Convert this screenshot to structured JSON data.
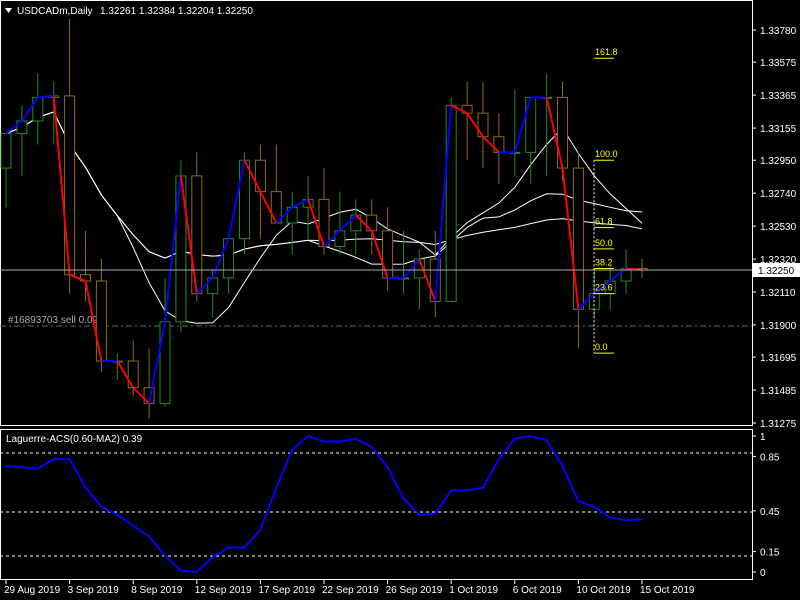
{
  "header": {
    "symbol_label": "USDCADm,Daily",
    "ohlc": "1.32261 1.32384 1.32204 1.32250",
    "menu_icon": "triangle-down-icon"
  },
  "order_label": "#16893703 sell 0.02",
  "indicator_label": "Laguerre-ACS(0.60-MA2) 0.39",
  "price_axis": {
    "ticks": [
      "1.33780",
      "1.33575",
      "1.33365",
      "1.33155",
      "1.32950",
      "1.32740",
      "1.32530",
      "1.32320",
      "1.32110",
      "1.31900",
      "1.31695",
      "1.31485",
      "1.31275"
    ],
    "current_price": "1.32250"
  },
  "indicator_axis": {
    "ticks": [
      "1",
      "0.85",
      "0.45",
      "0.15",
      "0"
    ]
  },
  "time_axis": {
    "labels": [
      "29 Aug 2019",
      "3 Sep 2019",
      "8 Sep 2019",
      "12 Sep 2019",
      "17 Sep 2019",
      "22 Sep 2019",
      "26 Sep 2019",
      "1 Oct 2019",
      "6 Oct 2019",
      "10 Oct 2019",
      "15 Oct 2019"
    ]
  },
  "fibonacci": {
    "levels": [
      "161.8",
      "100.0",
      "61.8",
      "50.0",
      "38.2",
      "23.6",
      "0.0"
    ]
  },
  "colors": {
    "background": "#000000",
    "axis": "#ffffff",
    "bull_candle": "#228b22",
    "bear_candle": "#8b6b1e",
    "zigzag_up": "#0000ff",
    "zigzag_down": "#ff0000",
    "moving_average": "#ffffff",
    "fib": "#ffff00",
    "order_line": "#2e8b2e",
    "indicator": "#0000ff"
  },
  "chart_data": [
    {
      "type": "candlestick",
      "title": "USDCADm,Daily",
      "ylim": [
        1.3125,
        1.339
      ],
      "x": [
        "29 Aug 2019",
        "30 Aug 2019",
        "1 Sep 2019",
        "2 Sep 2019",
        "3 Sep 2019",
        "4 Sep 2019",
        "5 Sep 2019",
        "6 Sep 2019",
        "8 Sep 2019",
        "9 Sep 2019",
        "10 Sep 2019",
        "11 Sep 2019",
        "12 Sep 2019",
        "13 Sep 2019",
        "15 Sep 2019",
        "16 Sep 2019",
        "17 Sep 2019",
        "18 Sep 2019",
        "19 Sep 2019",
        "20 Sep 2019",
        "22 Sep 2019",
        "23 Sep 2019",
        "24 Sep 2019",
        "25 Sep 2019",
        "26 Sep 2019",
        "27 Sep 2019",
        "29 Sep 2019",
        "30 Sep 2019",
        "1 Oct 2019",
        "2 Oct 2019",
        "3 Oct 2019",
        "4 Oct 2019",
        "6 Oct 2019",
        "7 Oct 2019",
        "8 Oct 2019",
        "9 Oct 2019",
        "10 Oct 2019",
        "11 Oct 2019",
        "13 Oct 2019",
        "14 Oct 2019",
        "15 Oct 2019"
      ],
      "series": [
        {
          "name": "open",
          "values": [
            1.329,
            1.3312,
            1.332,
            1.3335,
            1.3336,
            1.3222,
            1.3218,
            1.3167,
            1.3167,
            1.315,
            1.314,
            1.3192,
            1.3285,
            1.321,
            1.322,
            1.3245,
            1.3295,
            1.3275,
            1.3255,
            1.3265,
            1.327,
            1.324,
            1.325,
            1.326,
            1.325,
            1.322,
            1.322,
            1.3232,
            1.3205,
            1.333,
            1.3325,
            1.331,
            1.33,
            1.33,
            1.3335,
            1.3335,
            1.329,
            1.32,
            1.321,
            1.3218,
            1.3226
          ]
        },
        {
          "name": "high",
          "values": [
            1.3305,
            1.333,
            1.335,
            1.3345,
            1.3385,
            1.325,
            1.3232,
            1.3172,
            1.318,
            1.3175,
            1.322,
            1.3295,
            1.33,
            1.3225,
            1.3248,
            1.33,
            1.3305,
            1.3305,
            1.3275,
            1.3285,
            1.329,
            1.3275,
            1.327,
            1.327,
            1.3265,
            1.325,
            1.3238,
            1.325,
            1.3335,
            1.3345,
            1.3345,
            1.3325,
            1.334,
            1.3335,
            1.335,
            1.3345,
            1.33,
            1.3225,
            1.3228,
            1.3238,
            1.3232
          ]
        },
        {
          "name": "low",
          "values": [
            1.3265,
            1.3285,
            1.3305,
            1.3305,
            1.321,
            1.3205,
            1.316,
            1.3155,
            1.3145,
            1.313,
            1.3138,
            1.3185,
            1.3205,
            1.3195,
            1.321,
            1.3235,
            1.3245,
            1.3255,
            1.3235,
            1.3245,
            1.3235,
            1.3235,
            1.3235,
            1.3235,
            1.3212,
            1.321,
            1.32,
            1.3195,
            1.3205,
            1.3295,
            1.329,
            1.328,
            1.3285,
            1.328,
            1.3285,
            1.3282,
            1.3175,
            1.3195,
            1.32,
            1.321,
            1.322
          ]
        },
        {
          "name": "close",
          "values": [
            1.3312,
            1.332,
            1.3335,
            1.3336,
            1.3222,
            1.3218,
            1.3167,
            1.3167,
            1.315,
            1.314,
            1.3192,
            1.3285,
            1.321,
            1.322,
            1.3245,
            1.3295,
            1.3275,
            1.3255,
            1.3265,
            1.327,
            1.324,
            1.325,
            1.326,
            1.325,
            1.322,
            1.322,
            1.3232,
            1.3205,
            1.333,
            1.3325,
            1.331,
            1.33,
            1.33,
            1.3335,
            1.3335,
            1.329,
            1.32,
            1.321,
            1.3218,
            1.3226,
            1.3225
          ]
        }
      ]
    },
    {
      "type": "line",
      "title": "Laguerre-ACS(0.60-MA2) 0.39",
      "ylim": [
        0,
        1
      ],
      "x": [
        "29 Aug 2019",
        "30 Aug 2019",
        "1 Sep 2019",
        "2 Sep 2019",
        "3 Sep 2019",
        "4 Sep 2019",
        "5 Sep 2019",
        "6 Sep 2019",
        "8 Sep 2019",
        "9 Sep 2019",
        "10 Sep 2019",
        "11 Sep 2019",
        "12 Sep 2019",
        "13 Sep 2019",
        "15 Sep 2019",
        "16 Sep 2019",
        "17 Sep 2019",
        "18 Sep 2019",
        "19 Sep 2019",
        "20 Sep 2019",
        "22 Sep 2019",
        "23 Sep 2019",
        "24 Sep 2019",
        "25 Sep 2019",
        "26 Sep 2019",
        "27 Sep 2019",
        "29 Sep 2019",
        "30 Sep 2019",
        "1 Oct 2019",
        "2 Oct 2019",
        "3 Oct 2019",
        "4 Oct 2019",
        "6 Oct 2019",
        "7 Oct 2019",
        "8 Oct 2019",
        "9 Oct 2019",
        "10 Oct 2019",
        "11 Oct 2019",
        "13 Oct 2019",
        "14 Oct 2019",
        "15 Oct 2019"
      ],
      "series": [
        {
          "name": "Laguerre-ACS",
          "values": [
            0.78,
            0.77,
            0.76,
            0.83,
            0.83,
            0.62,
            0.48,
            0.42,
            0.34,
            0.26,
            0.12,
            0.01,
            0.0,
            0.11,
            0.18,
            0.18,
            0.31,
            0.62,
            0.9,
            1.0,
            0.96,
            0.96,
            0.98,
            0.92,
            0.77,
            0.54,
            0.42,
            0.43,
            0.6,
            0.6,
            0.62,
            0.83,
            0.98,
            1.0,
            0.97,
            0.78,
            0.52,
            0.48,
            0.4,
            0.38,
            0.39
          ]
        }
      ]
    }
  ]
}
